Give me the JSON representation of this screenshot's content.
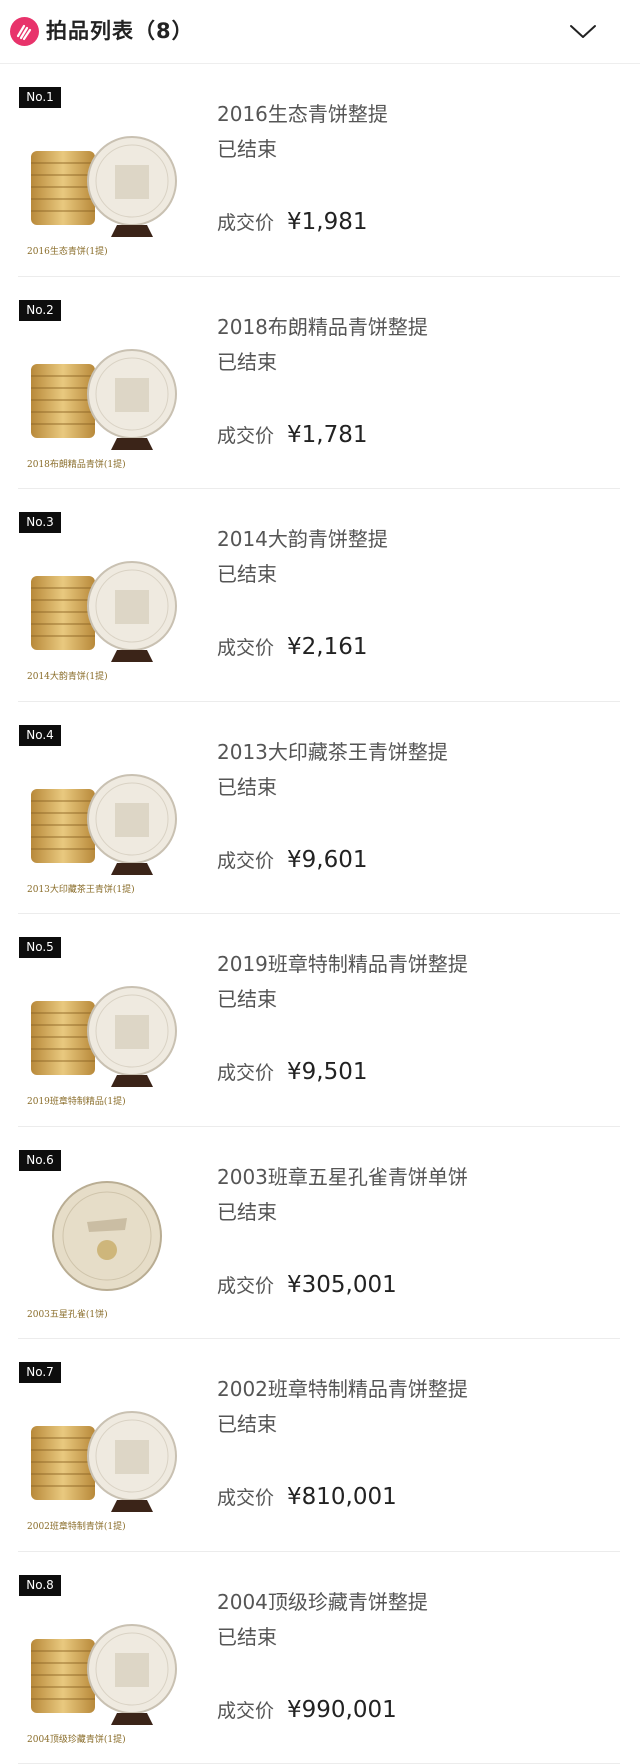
{
  "header": {
    "title": "拍品列表（8）",
    "logo_icon": "auction-logo-icon",
    "toggle_icon": "chevron-down-icon",
    "accent_color": "#e8336b"
  },
  "items": [
    {
      "no": "No.1",
      "name": "2016生态青饼整提",
      "status": "已结束",
      "price_label": "成交价",
      "price": "¥1,981",
      "caption": "2016生态青饼(1提)",
      "type": "stack"
    },
    {
      "no": "No.2",
      "name": "2018布朗精品青饼整提",
      "status": "已结束",
      "price_label": "成交价",
      "price": "¥1,781",
      "caption": "2018布朗精品青饼(1提)",
      "type": "stack"
    },
    {
      "no": "No.3",
      "name": "2014大韵青饼整提",
      "status": "已结束",
      "price_label": "成交价",
      "price": "¥2,161",
      "caption": "2014大韵青饼(1提)",
      "type": "stack"
    },
    {
      "no": "No.4",
      "name": "2013大印藏茶王青饼整提",
      "status": "已结束",
      "price_label": "成交价",
      "price": "¥9,601",
      "caption": "2013大印藏茶王青饼(1提)",
      "type": "stack"
    },
    {
      "no": "No.5",
      "name": "2019班章特制精品青饼整提",
      "status": "已结束",
      "price_label": "成交价",
      "price": "¥9,501",
      "caption": "2019班章特制精品(1提)",
      "type": "stack"
    },
    {
      "no": "No.6",
      "name": "2003班章五星孔雀青饼单饼",
      "status": "已结束",
      "price_label": "成交价",
      "price": "¥305,001",
      "caption": "2003五星孔雀(1饼)",
      "type": "single"
    },
    {
      "no": "No.7",
      "name": "2002班章特制精品青饼整提",
      "status": "已结束",
      "price_label": "成交价",
      "price": "¥810,001",
      "caption": "2002班章特制青饼(1提)",
      "type": "stack"
    },
    {
      "no": "No.8",
      "name": "2004顶级珍藏青饼整提",
      "status": "已结束",
      "price_label": "成交价",
      "price": "¥990,001",
      "caption": "2004顶级珍藏青饼(1提)",
      "type": "stack"
    }
  ]
}
